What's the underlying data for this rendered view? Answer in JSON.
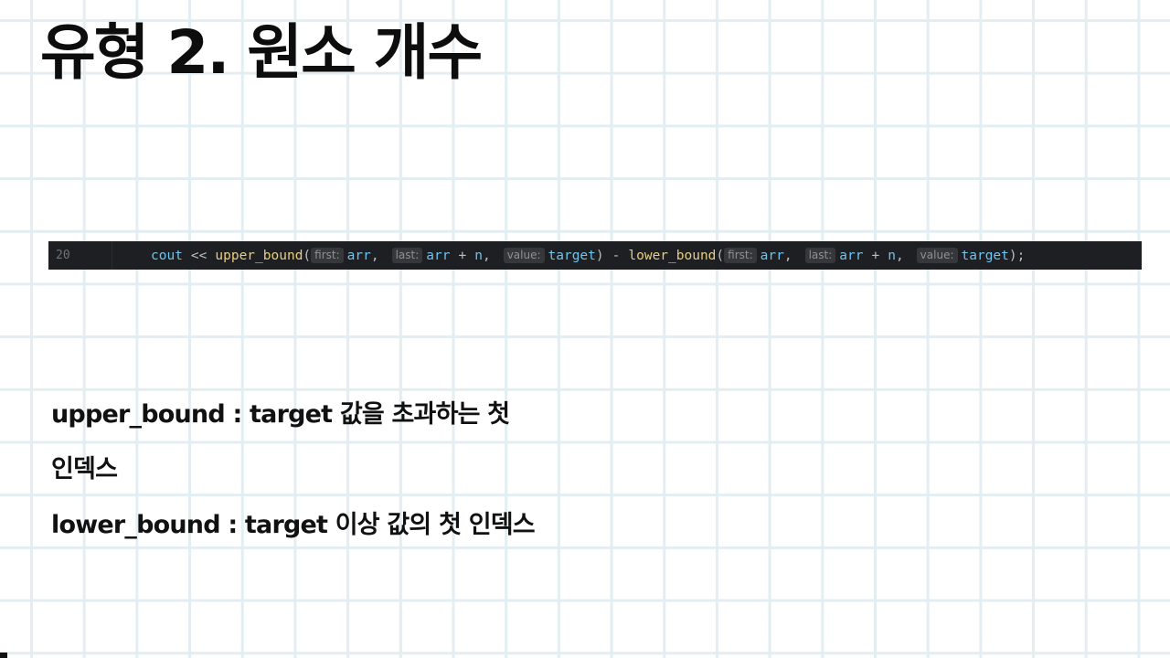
{
  "title": "유형 2. 원소 개수",
  "code": {
    "line_number": "20",
    "tokens": {
      "cout": "cout",
      "shift": "<<",
      "upper_bound": "upper_bound",
      "lower_bound": "lower_bound",
      "open_paren": "(",
      "hint_first": "first:",
      "hint_last": "last:",
      "hint_value": "value:",
      "arr": "arr",
      "comma": ",",
      "plus": "+",
      "n": "n",
      "target": "target",
      "close_paren": ")",
      "minus": "-",
      "close_semicolon": ");"
    }
  },
  "explanations": {
    "upper_line1": "upper_bound : target 값을 초과하는 첫",
    "upper_line2": "인덱스",
    "lower": "lower_bound : target 이상 값의 첫 인덱스"
  },
  "colors": {
    "code_background": "#1e1f22",
    "identifier": "#6fc3ef",
    "function": "#e6cd84",
    "hint_background": "#35373b",
    "grid_line": "#e3eef2"
  }
}
